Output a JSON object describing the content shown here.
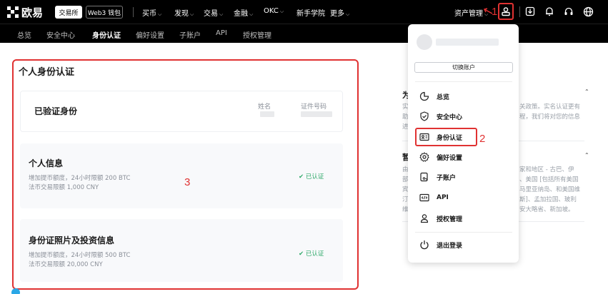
{
  "topbar": {
    "logo": "欧易",
    "exchange_tab": "交易所",
    "web3_tab": "Web3 钱包",
    "nav": [
      "买币",
      "发现",
      "交易",
      "金融",
      "OKC",
      "新手学院",
      "更多"
    ],
    "asset_management": "资产管理"
  },
  "annotations": {
    "one": "1",
    "two": "2",
    "three": "3"
  },
  "subnav": [
    "总览",
    "安全中心",
    "身份认证",
    "偏好设置",
    "子账户",
    "API",
    "授权管理"
  ],
  "main": {
    "title": "个人身份认证",
    "verified": {
      "label": "已验证身份",
      "col_name": "姓名",
      "col_id": "证件号码"
    },
    "personal_info": {
      "title": "个人信息",
      "line1": "增加提币额度，24小时限额 200 BTC",
      "line2": "法币交易限额 1,000 CNY",
      "status": "✔ 已认证"
    },
    "id_photo": {
      "title": "身份证照片及投资信息",
      "line1": "增加提币额度，24小时限额 500 BTC",
      "line2": "法币交易限额 20,000 CNY",
      "status": "✔ 已认证"
    }
  },
  "background": {
    "sec1_title": "为",
    "sec1_lines": [
      "实",
      "助",
      "进"
    ],
    "sec1_right": [
      "关政策。实名认证更有",
      "程，我们将对您的信息"
    ],
    "sec2_title": "暂",
    "sec2_lines": [
      "由",
      "部",
      "宾",
      "汀",
      "维"
    ],
    "sec2_right": [
      "家和地区 - 古巴、伊",
      "、美国 [包括所有美国",
      "马里亚纳岛、和美国维",
      "斯]、孟加拉国、玻利",
      "安大略省、新加坡。"
    ]
  },
  "dropdown": {
    "switch_account": "切换账户",
    "items": [
      {
        "label": "总览",
        "icon": "overview-icon"
      },
      {
        "label": "安全中心",
        "icon": "shield-icon"
      },
      {
        "label": "身份认证",
        "icon": "id-card-icon"
      },
      {
        "label": "偏好设置",
        "icon": "gear-icon"
      },
      {
        "label": "子账户",
        "icon": "sub-account-icon"
      },
      {
        "label": "API",
        "icon": "api-icon"
      },
      {
        "label": "授权管理",
        "icon": "authorization-icon"
      }
    ],
    "logout": "退出登录"
  },
  "colors": {
    "annotation_red": "#e03232",
    "verified_green": "#2fa96a",
    "topbar_black": "#000000"
  }
}
